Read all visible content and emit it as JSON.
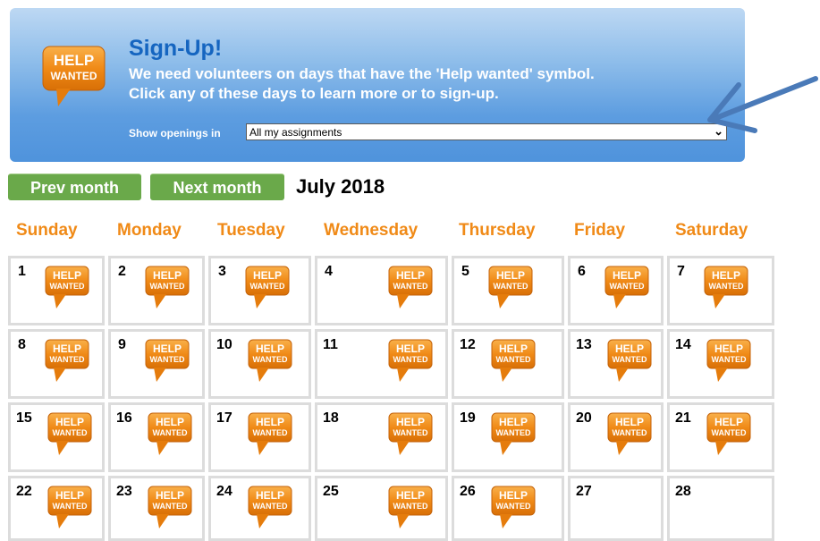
{
  "banner": {
    "icon_line1": "HELP",
    "icon_line2": "WANTED",
    "title": "Sign-Up!",
    "line1": "We need volunteers on days that have the 'Help wanted' symbol.",
    "line2": "Click any of these days to learn more or to sign-up.",
    "filter_label": "Show openings in",
    "filter_value": "All my assignments"
  },
  "nav": {
    "prev_label": "Prev month",
    "next_label": "Next month",
    "month_title": "July 2018"
  },
  "badge": {
    "line1": "HELP",
    "line2": "WANTED"
  },
  "weekdays": [
    "Sunday",
    "Monday",
    "Tuesday",
    "Wednesday",
    "Thursday",
    "Friday",
    "Saturday"
  ],
  "weeks": [
    [
      {
        "day": "1",
        "help": true
      },
      {
        "day": "2",
        "help": true
      },
      {
        "day": "3",
        "help": true
      },
      {
        "day": "4",
        "help": true
      },
      {
        "day": "5",
        "help": true
      },
      {
        "day": "6",
        "help": true
      },
      {
        "day": "7",
        "help": true
      }
    ],
    [
      {
        "day": "8",
        "help": true
      },
      {
        "day": "9",
        "help": true
      },
      {
        "day": "10",
        "help": true
      },
      {
        "day": "11",
        "help": true
      },
      {
        "day": "12",
        "help": true
      },
      {
        "day": "13",
        "help": true
      },
      {
        "day": "14",
        "help": true
      }
    ],
    [
      {
        "day": "15",
        "help": true
      },
      {
        "day": "16",
        "help": true
      },
      {
        "day": "17",
        "help": true
      },
      {
        "day": "18",
        "help": true
      },
      {
        "day": "19",
        "help": true
      },
      {
        "day": "20",
        "help": true
      },
      {
        "day": "21",
        "help": true
      }
    ],
    [
      {
        "day": "22",
        "help": true
      },
      {
        "day": "23",
        "help": true
      },
      {
        "day": "24",
        "help": true
      },
      {
        "day": "25",
        "help": true
      },
      {
        "day": "26",
        "help": true
      },
      {
        "day": "27",
        "help": false
      },
      {
        "day": "28",
        "help": false
      }
    ]
  ],
  "colors": {
    "banner_blue": "#4f93dc",
    "title_blue": "#1565c0",
    "badge_orange": "#f08a17",
    "button_green": "#6aa94a",
    "weekday_orange": "#f08a17",
    "arrow_blue": "#4a7ab8"
  }
}
